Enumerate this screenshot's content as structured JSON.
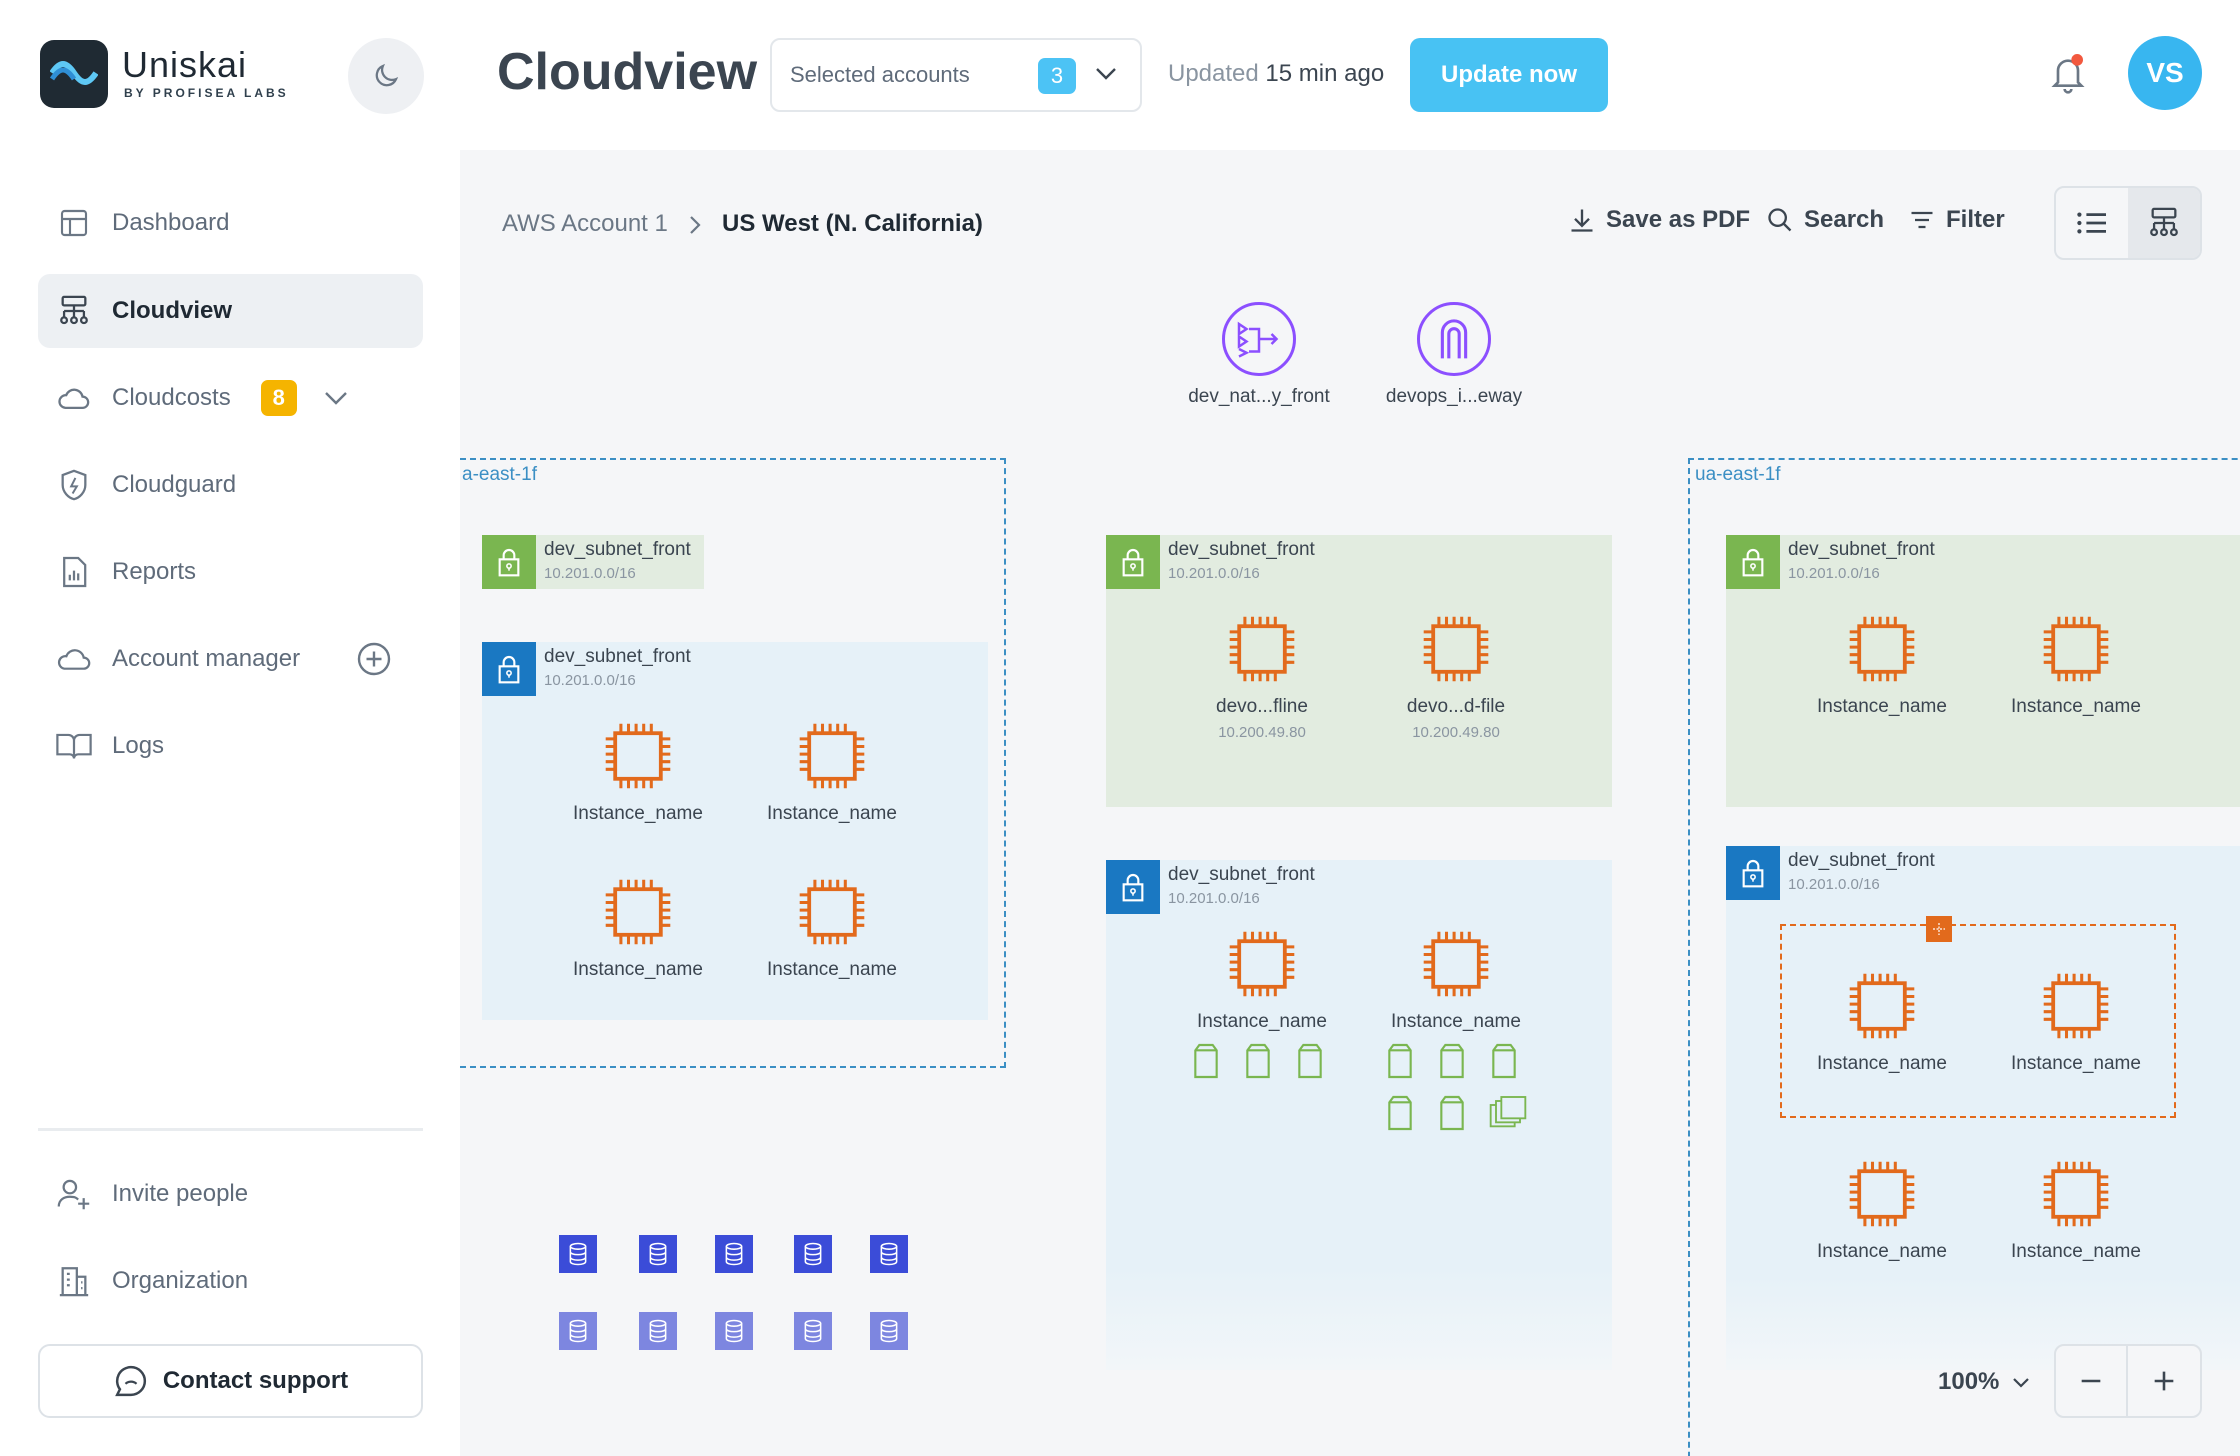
{
  "brand": {
    "name": "Uniskai",
    "sub": "BY PROFISEA LABS"
  },
  "nav": {
    "dashboard": "Dashboard",
    "cloudview": "Cloudview",
    "cloudcosts": "Cloudcosts",
    "cloudcosts_badge": "8",
    "cloudguard": "Cloudguard",
    "reports": "Reports",
    "account_manager": "Account manager",
    "logs": "Logs",
    "invite": "Invite people",
    "organization": "Organization",
    "contact": "Contact support"
  },
  "header": {
    "title": "Cloudview",
    "accounts_placeholder": "Selected accounts",
    "accounts_count": "3",
    "updated_prefix": "Updated",
    "updated_time": "15 min ago",
    "update_button": "Update now",
    "avatar_initials": "VS",
    "accent": "#48c2f3"
  },
  "breadcrumb": {
    "account": "AWS Account 1",
    "region": "US West (N. California)"
  },
  "toolbar": {
    "save_pdf": "Save as PDF",
    "search": "Search",
    "filter": "Filter"
  },
  "gateways": {
    "nat": "dev_nat...y_front",
    "igw": "devops_i...eway"
  },
  "zones": {
    "left": "a-east-1f",
    "right": "ua-east-1f"
  },
  "subnet": {
    "name": "dev_subnet_front",
    "cidr": "10.201.0.0/16"
  },
  "instances": {
    "generic": "Instance_name",
    "offline": "devo...fline",
    "dfile": "devo...d-file",
    "ip": "10.200.49.80"
  },
  "zoom": {
    "level": "100%"
  },
  "colors": {
    "ec2": "#e26a1c",
    "subnet_public": "#7ab650",
    "subnet_private": "#1a78c2",
    "gateway": "#8c4fff",
    "db": "#3b4cd8"
  }
}
